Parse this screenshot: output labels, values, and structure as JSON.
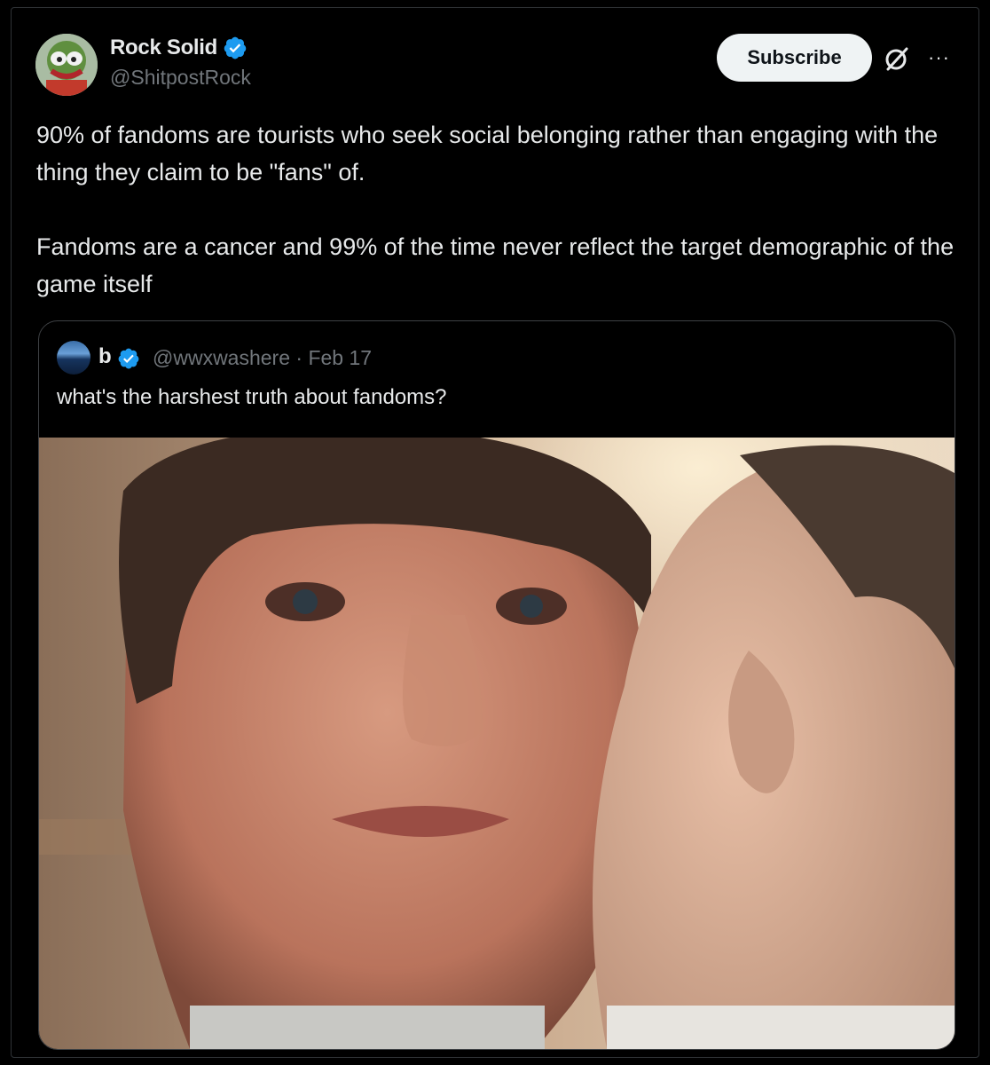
{
  "post": {
    "author": {
      "display_name": "Rock Solid",
      "handle": "@ShitpostRock"
    },
    "subscribe_label": "Subscribe",
    "more_label": "···",
    "paragraphs": [
      "90% of fandoms are tourists who seek social belonging rather than engaging with the thing they claim to be \"fans\" of.",
      "Fandoms are a cancer and 99% of the time never reflect the target demographic of the game itself"
    ]
  },
  "quote": {
    "author": {
      "display_name": "b",
      "handle_date": "@wwxwashere · Feb 17"
    },
    "text": "what's the harshest truth about fandoms?"
  },
  "colors": {
    "verified": "#1d9bf0",
    "subscribe_bg": "#eff3f4",
    "handle": "#71767b"
  },
  "icons": [
    "verified-badge-icon",
    "grok-icon",
    "more-icon"
  ]
}
